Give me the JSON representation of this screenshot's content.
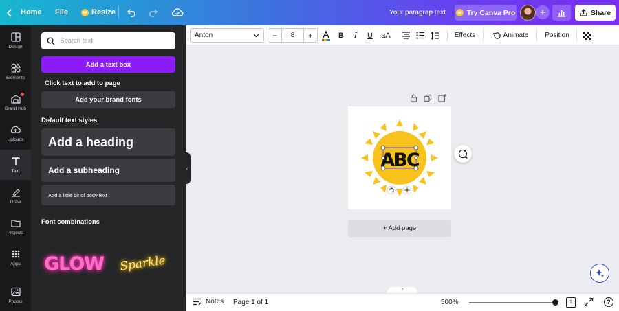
{
  "topbar": {
    "home_label": "Home",
    "file_label": "File",
    "resize_label": "Resize",
    "doc_title": "Your paragrap text",
    "pro_label": "Try Canva Pro",
    "share_label": "Share"
  },
  "rail": {
    "items": [
      {
        "label": "Design",
        "icon": "layout-icon"
      },
      {
        "label": "Elements",
        "icon": "shapes-icon"
      },
      {
        "label": "Brand Hub",
        "icon": "brand-icon"
      },
      {
        "label": "Uploads",
        "icon": "cloud-upload-icon"
      },
      {
        "label": "Text",
        "icon": "text-icon"
      },
      {
        "label": "Draw",
        "icon": "pen-icon"
      },
      {
        "label": "Projects",
        "icon": "folder-icon"
      },
      {
        "label": "Apps",
        "icon": "apps-grid-icon"
      },
      {
        "label": "Photos",
        "icon": "image-icon"
      }
    ],
    "active_index": 4
  },
  "panel": {
    "search_placeholder": "Search text",
    "add_textbox_label": "Add a text box",
    "hint": "Click text to add to page",
    "brand_fonts_label": "Add your brand fonts",
    "default_styles_title": "Default text styles",
    "heading_label": "Add a heading",
    "subheading_label": "Add a subheading",
    "body_label": "Add a little bit of body text",
    "combinations_title": "Font combinations",
    "combo_glow": "GLOW",
    "combo_sparkle": "Sparkle"
  },
  "toolbar": {
    "font_name": "Anton",
    "font_size": "8",
    "minus": "−",
    "plus": "+",
    "effects_label": "Effects",
    "animate_label": "Animate",
    "position_label": "Position"
  },
  "canvas": {
    "logo_text": "ABC",
    "add_page_label": "+ Add page",
    "colors": {
      "sun": "#f7c21b",
      "text": "#111111"
    }
  },
  "bottombar": {
    "notes_label": "Notes",
    "page_label": "Page 1 of 1",
    "zoom_label": "500%",
    "zoom_fraction": 1.0,
    "grid_count": "1",
    "help_label": "?"
  },
  "colors": {
    "accent": "#8b1bf7",
    "panel_bg": "#252627",
    "rail_bg": "#18191b"
  }
}
